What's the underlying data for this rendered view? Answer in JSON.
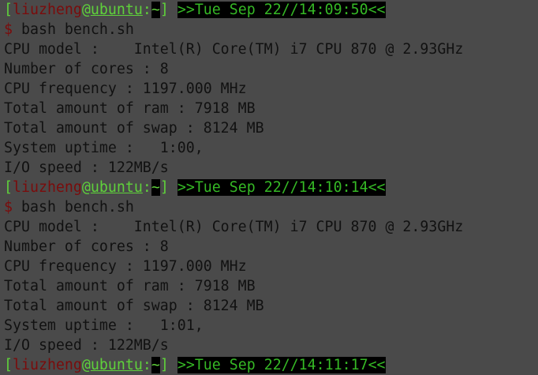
{
  "blocks": [
    {
      "prompt": {
        "open": "[",
        "user": "liuzheng",
        "at": "@",
        "host": "ubuntu",
        "colon": ":",
        "dir": "~",
        "close": "]",
        "timestamp": ">>Tue Sep 22//14:09:50<<"
      },
      "command": {
        "symbol": "$",
        "text": "bash bench.sh"
      },
      "output": [
        "CPU model :    Intel(R) Core(TM) i7 CPU 870 @ 2.93GHz",
        "Number of cores : 8",
        "CPU frequency : 1197.000 MHz",
        "Total amount of ram : 7918 MB",
        "Total amount of swap : 8124 MB",
        "System uptime :   1:00,",
        "I/O speed : 122MB/s"
      ]
    },
    {
      "prompt": {
        "open": "[",
        "user": "liuzheng",
        "at": "@",
        "host": "ubuntu",
        "colon": ":",
        "dir": "~",
        "close": "]",
        "timestamp": ">>Tue Sep 22//14:10:14<<"
      },
      "command": {
        "symbol": "$",
        "text": "bash bench.sh"
      },
      "output": [
        "CPU model :    Intel(R) Core(TM) i7 CPU 870 @ 2.93GHz",
        "Number of cores : 8",
        "CPU frequency : 1197.000 MHz",
        "Total amount of ram : 7918 MB",
        "Total amount of swap : 8124 MB",
        "System uptime :   1:01,",
        "I/O speed : 122MB/s"
      ]
    }
  ],
  "partial_prompt": {
    "open": "[",
    "user": "liuzheng",
    "at": "@",
    "host": "ubuntu",
    "colon": ":",
    "dir": "~",
    "close": "]",
    "timestamp": ">>Tue Sep 22//14:11:17<<"
  }
}
